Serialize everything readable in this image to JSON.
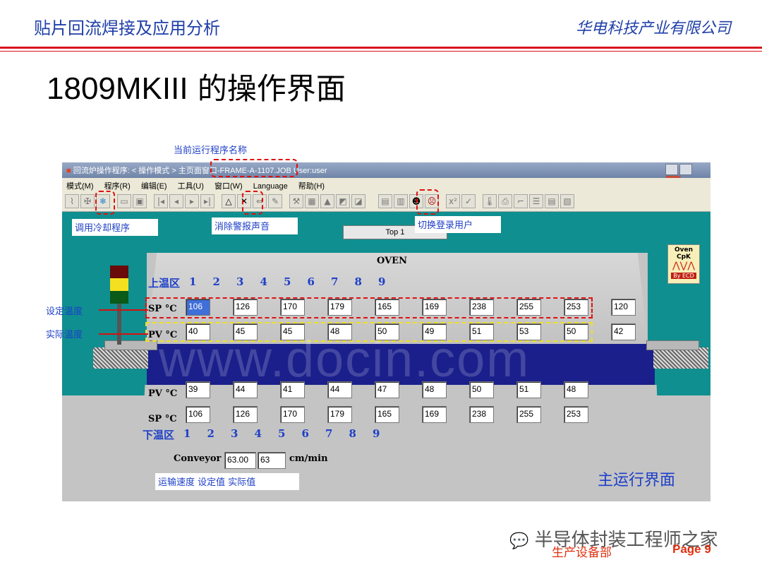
{
  "slide": {
    "header_left": "贴片回流焊接及应用分析",
    "header_right": "华电科技产业有限公司",
    "title_latin": "1809MKIII",
    "title_cn": " 的操作界面",
    "footer_dept": "生产设备部",
    "footer_page": "Page 9",
    "wechat_label": "半导体封装工程师之家",
    "watermark": "www.docin.com",
    "accent_color": "#d8121b",
    "annotation_color": "#1e3fc8"
  },
  "annotations": {
    "program_name": "当前运行程序名称",
    "call_cooling": "调用冷却程序",
    "clear_alarm": "消除警报声音",
    "switch_user": "切换登录用户",
    "set_temp": "设定温度",
    "actual_temp": "实际温度",
    "conveyor_note": "运输速度 设定值 实际值",
    "main_ui": "主运行界面"
  },
  "window": {
    "title": "回流炉操作程序: < 操作模式 > 主页面窗口-FRAME-A-1107.JOB User:user",
    "menu": [
      "模式(M)",
      "程序(R)",
      "编辑(E)",
      "工具(U)",
      "窗口(W)",
      "Language",
      "帮助(H)"
    ]
  },
  "oven": {
    "label": "OVEN",
    "top_status": "Top 1",
    "upper_zone_label": "上温区",
    "lower_zone_label": "下温区",
    "zones": [
      "1",
      "2",
      "3",
      "4",
      "5",
      "6",
      "7",
      "8",
      "9"
    ],
    "sp_label": "SP °C",
    "pv_label": "PV °C",
    "upper_sp": [
      "106",
      "126",
      "170",
      "179",
      "165",
      "169",
      "238",
      "255",
      "253"
    ],
    "upper_pv": [
      "40",
      "45",
      "45",
      "48",
      "50",
      "49",
      "51",
      "53",
      "50"
    ],
    "extra_sp": "120",
    "extra_pv": "42",
    "lower_pv": [
      "39",
      "44",
      "41",
      "44",
      "47",
      "48",
      "50",
      "51",
      "48"
    ],
    "lower_sp": [
      "106",
      "126",
      "170",
      "179",
      "165",
      "169",
      "238",
      "255",
      "253"
    ],
    "conveyor_label": "Conveyor 1",
    "conveyor_set": "63.00",
    "conveyor_actual": "63",
    "conveyor_unit": "cm/min",
    "cpk_title": "Oven CpK",
    "cpk_by": "By ECD"
  }
}
